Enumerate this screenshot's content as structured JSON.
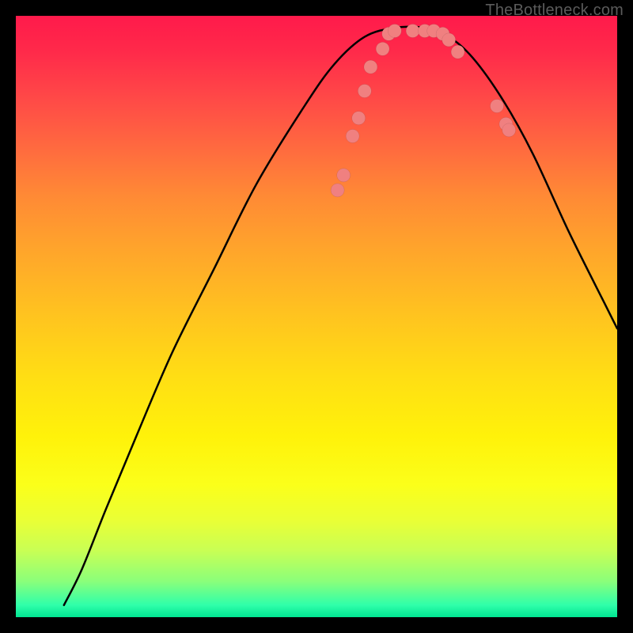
{
  "watermark": "TheBottleneck.com",
  "chart_data": {
    "type": "line",
    "title": "",
    "xlabel": "",
    "ylabel": "",
    "xlim": [
      0,
      100
    ],
    "ylim": [
      0,
      100
    ],
    "grid": false,
    "curve": {
      "name": "bottleneck-curve",
      "points": [
        {
          "x": 8,
          "y": 2
        },
        {
          "x": 11,
          "y": 8
        },
        {
          "x": 15,
          "y": 18
        },
        {
          "x": 20,
          "y": 30
        },
        {
          "x": 26,
          "y": 44
        },
        {
          "x": 33,
          "y": 58
        },
        {
          "x": 40,
          "y": 72
        },
        {
          "x": 48,
          "y": 85
        },
        {
          "x": 53,
          "y": 92
        },
        {
          "x": 58,
          "y": 96.5
        },
        {
          "x": 63,
          "y": 98
        },
        {
          "x": 68,
          "y": 98
        },
        {
          "x": 72,
          "y": 96.5
        },
        {
          "x": 76,
          "y": 93
        },
        {
          "x": 81,
          "y": 86
        },
        {
          "x": 86,
          "y": 77
        },
        {
          "x": 92,
          "y": 64
        },
        {
          "x": 98,
          "y": 52
        },
        {
          "x": 100,
          "y": 48
        }
      ]
    },
    "scatter": {
      "name": "data-points",
      "points": [
        {
          "x": 53.5,
          "y": 71
        },
        {
          "x": 54.5,
          "y": 73.5
        },
        {
          "x": 56,
          "y": 80
        },
        {
          "x": 57,
          "y": 83
        },
        {
          "x": 58,
          "y": 87.5
        },
        {
          "x": 59,
          "y": 91.5
        },
        {
          "x": 61,
          "y": 94.5
        },
        {
          "x": 62,
          "y": 97
        },
        {
          "x": 63,
          "y": 97.5
        },
        {
          "x": 66,
          "y": 97.5
        },
        {
          "x": 68,
          "y": 97.5
        },
        {
          "x": 69.5,
          "y": 97.5
        },
        {
          "x": 71,
          "y": 97
        },
        {
          "x": 72,
          "y": 96
        },
        {
          "x": 73.5,
          "y": 94
        },
        {
          "x": 80,
          "y": 85
        },
        {
          "x": 81.5,
          "y": 82
        },
        {
          "x": 82,
          "y": 81
        }
      ]
    },
    "colors": {
      "curve": "#000000",
      "dots": "#f08080",
      "gradient_top": "#ff1a4b",
      "gradient_bottom": "#00e592"
    }
  }
}
